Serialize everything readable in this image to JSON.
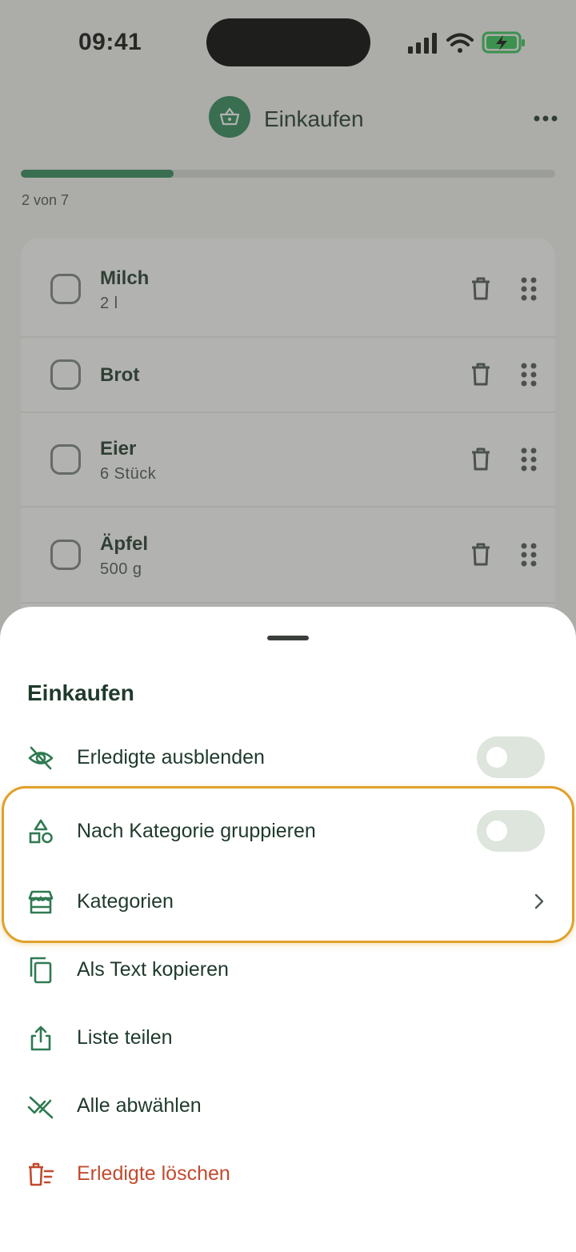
{
  "status_bar": {
    "time": "09:41"
  },
  "header": {
    "title": "Einkaufen"
  },
  "progress": {
    "text": "2 von 7",
    "done": 2,
    "total": 7
  },
  "items": [
    {
      "name": "Milch",
      "quantity": "2 l"
    },
    {
      "name": "Brot",
      "quantity": ""
    },
    {
      "name": "Eier",
      "quantity": "6 Stück"
    },
    {
      "name": "Äpfel",
      "quantity": "500 g"
    }
  ],
  "sheet": {
    "title": "Einkaufen",
    "options": [
      {
        "label": "Erledigte ausblenden",
        "icon": "eye-off-icon",
        "toggle_on": false
      },
      {
        "label": "Nach Kategorie gruppieren",
        "icon": "shapes-icon",
        "toggle_on": false
      },
      {
        "label": "Kategorien",
        "icon": "store-icon"
      },
      {
        "label": "Als Text kopieren",
        "icon": "copy-icon"
      },
      {
        "label": "Liste teilen",
        "icon": "share-icon"
      },
      {
        "label": "Alle abwählen",
        "icon": "uncheck-all-icon"
      },
      {
        "label": "Erledigte löschen",
        "icon": "delete-done-icon"
      }
    ]
  },
  "colors": {
    "accent": "#2f8a5b",
    "text": "#1f3a2c",
    "danger": "#c24a2e",
    "highlight": "#e0a12a"
  }
}
